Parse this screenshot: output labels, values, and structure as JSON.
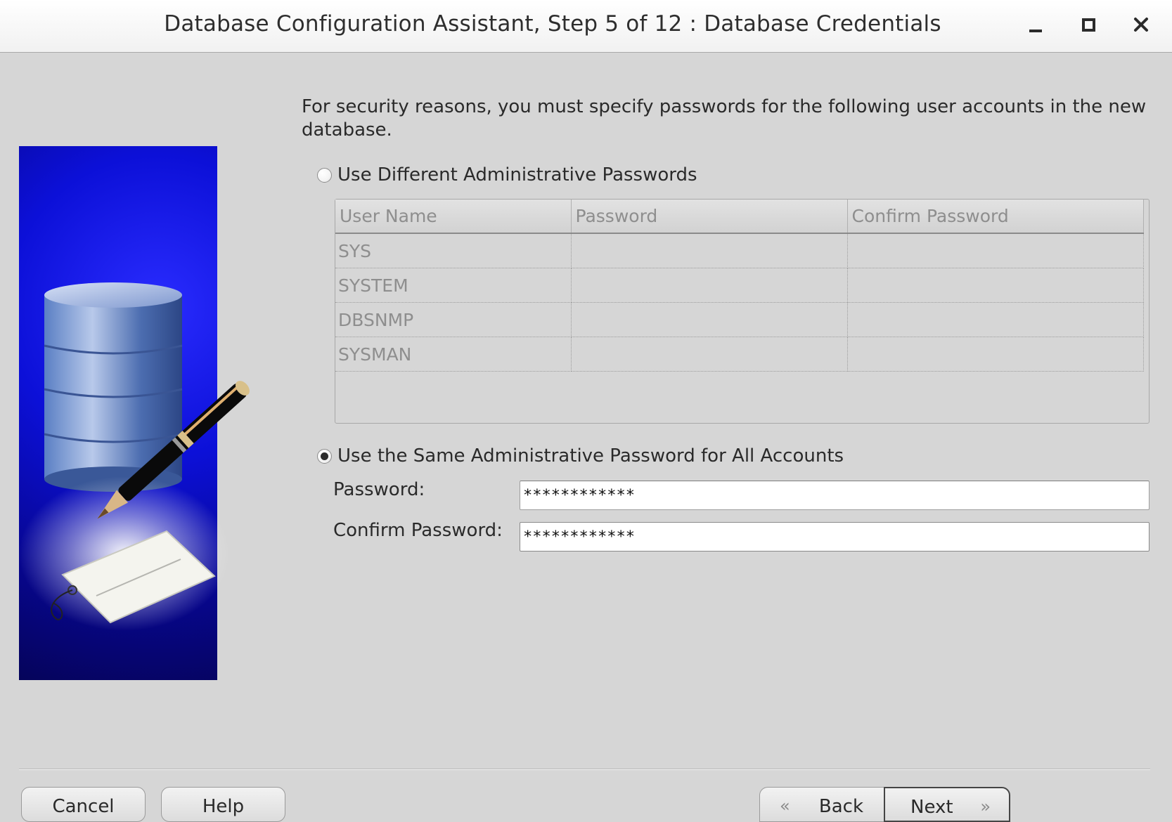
{
  "window": {
    "title": "Database Configuration Assistant, Step 5 of 12 : Database Credentials"
  },
  "intro_text": "For security reasons, you must specify passwords for the following user accounts in the new database.",
  "options": {
    "different": {
      "label": "Use Different Administrative Passwords",
      "selected": false
    },
    "same": {
      "label": "Use the Same Administrative Password for All Accounts",
      "selected": true
    }
  },
  "table": {
    "columns": [
      "User Name",
      "Password",
      "Confirm Password"
    ],
    "rows": [
      {
        "user": "SYS",
        "password": "",
        "confirm": ""
      },
      {
        "user": "SYSTEM",
        "password": "",
        "confirm": ""
      },
      {
        "user": "DBSNMP",
        "password": "",
        "confirm": ""
      },
      {
        "user": "SYSMAN",
        "password": "",
        "confirm": ""
      }
    ]
  },
  "password_form": {
    "password_label": "Password:",
    "password_value": "************",
    "confirm_label": "Confirm Password:",
    "confirm_value": "************"
  },
  "buttons": {
    "cancel": "Cancel",
    "help": "Help",
    "back": "Back",
    "next": "Next"
  },
  "icons": {
    "minimize": "minimize-icon",
    "maximize": "maximize-icon",
    "close": "close-icon",
    "back_arrow": "chevron-double-left-icon",
    "next_arrow": "chevron-double-right-icon"
  },
  "colors": {
    "banner_blue": "#0c10d8",
    "dialog_background": "#d6d6d6"
  }
}
